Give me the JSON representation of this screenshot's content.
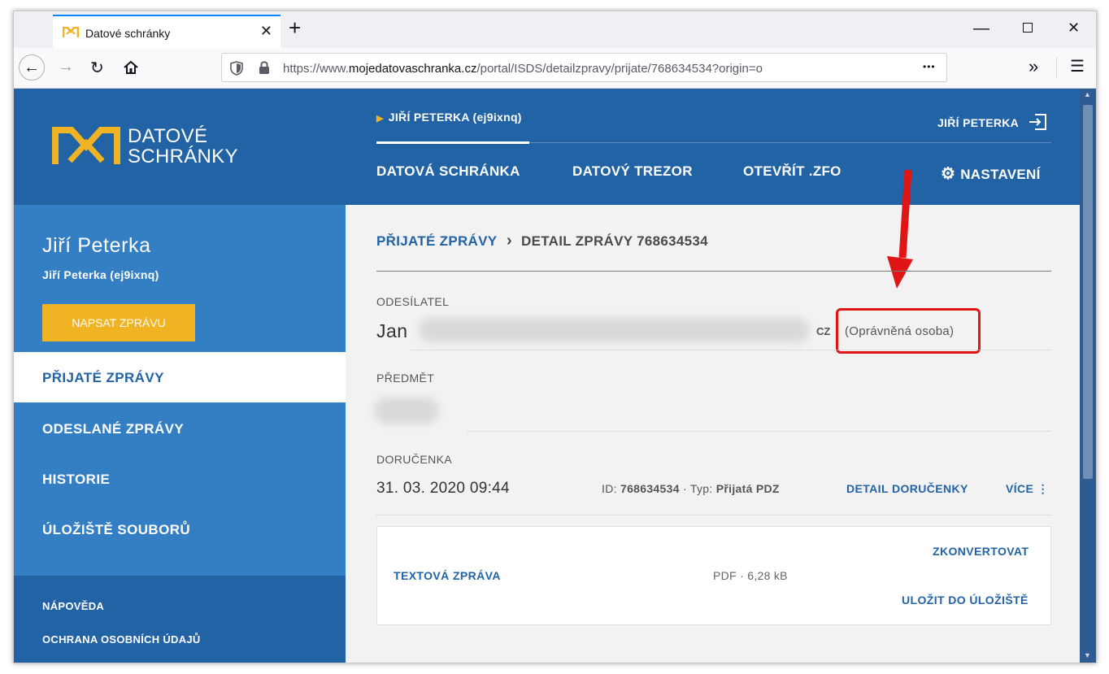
{
  "browser": {
    "tab_title": "Datové schránky",
    "url_prefix": "https://www.",
    "url_domain": "mojedatovaschranka.cz",
    "url_path": "/portal/ISDS/detailzpravy/prijate/768634534?origin=o",
    "url_more": "•••"
  },
  "header": {
    "logo_line1": "DATOVÉ",
    "logo_line2": "SCHRÁNKY",
    "current_box": "JIŘÍ PETERKA (ej9ixnq)",
    "user": "JIŘÍ PETERKA",
    "nav": [
      "DATOVÁ SCHRÁNKA",
      "DATOVÝ TREZOR",
      "OTEVŘÍT .ZFO"
    ],
    "settings": "NASTAVENÍ",
    "colors": {
      "brand_blue": "#2263a5",
      "accent_yellow": "#f0b323"
    }
  },
  "sidebar": {
    "name": "Jiří Peterka",
    "box_id": "Jiří Peterka (ej9ixnq)",
    "compose_button": "NAPSAT ZPRÁVU",
    "items": [
      "PŘIJATÉ ZPRÁVY",
      "ODESLANÉ ZPRÁVY",
      "HISTORIE",
      "ÚLOŽIŠTĚ SOUBORŮ"
    ],
    "footer": [
      "NÁPOVĚDA",
      "OCHRANA OSOBNÍCH ÚDAJŮ"
    ]
  },
  "main": {
    "breadcrumb_link": "PŘIJATÉ ZPRÁVY",
    "breadcrumb_sep": "›",
    "breadcrumb_current": "DETAIL ZPRÁVY 768634534",
    "sender_label": "ODESÍLATEL",
    "sender_first": "Jan",
    "sender_country": "CZ",
    "sender_role": "(Oprávněná osoba)",
    "subject_label": "PŘEDMĚT",
    "receipt_label": "DORUČENKA",
    "receipt_date": "31. 03. 2020 09:44",
    "id_label": "ID:",
    "id_value": "768634534",
    "type_label": "· Typ:",
    "type_value": "Přijatá PDZ",
    "receipt_detail": "DETAIL DORUČENKY",
    "more": "VÍCE",
    "attachment": {
      "name": "TEXTOVÁ ZPRÁVA",
      "info": "PDF · 6,28 kB",
      "convert": "ZKONVERTOVAT",
      "save": "ULOŽIT DO ÚLOŽIŠTĚ"
    }
  }
}
